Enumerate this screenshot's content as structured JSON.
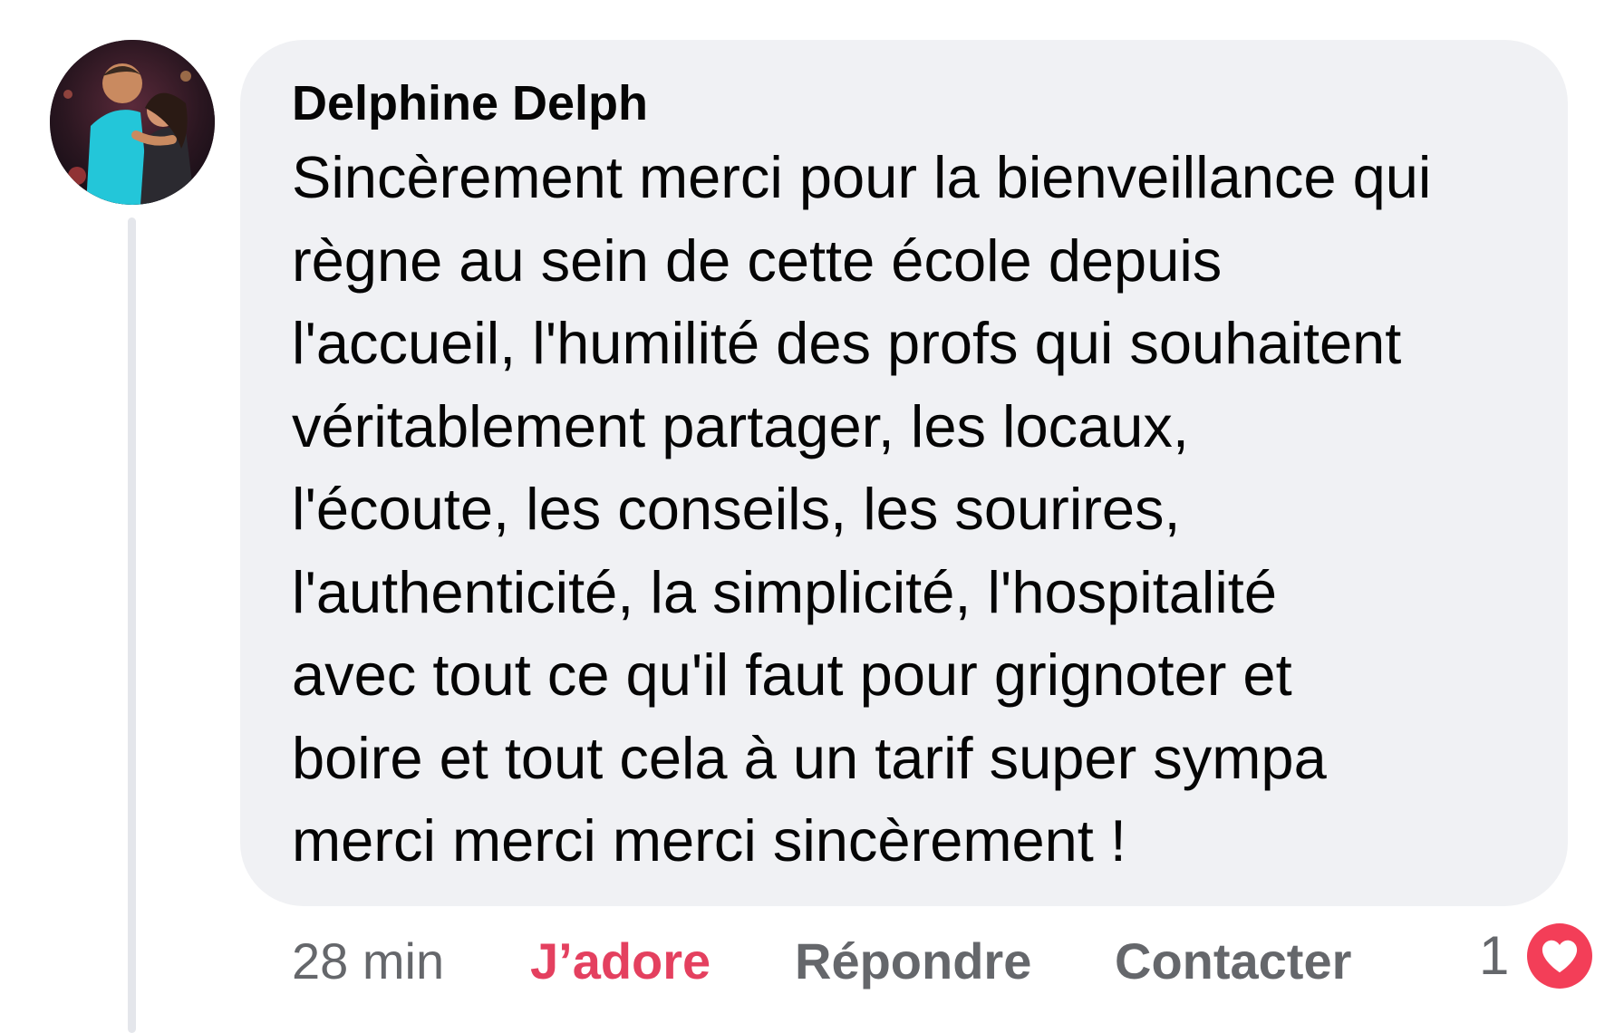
{
  "comment": {
    "author": "Delphine Delph",
    "lines": [
      "Sincèrement merci pour la bienveillance qui",
      "règne au sein de cette école depuis",
      "l'accueil, l'humilité des profs qui souhaitent",
      "véritablement partager, les locaux,",
      "l'écoute, les conseils, les sourires,",
      "l'authenticité, la simplicité, l'hospitalité",
      "avec tout ce qu'il faut pour grignoter et",
      "boire et tout cela à un tarif super sympa",
      "merci merci merci sincèrement !"
    ],
    "time": "28 min",
    "reaction_count": "1",
    "reaction_icon": "heart-icon"
  },
  "actions": {
    "adore_label": "J’adore",
    "reply_label": "Répondre",
    "contact_label": "Contacter"
  },
  "colors": {
    "bubble": "#f0f1f4",
    "text": "#050505",
    "secondary": "#65676b",
    "reaction_active": "#e4405f",
    "heart": "#f33e58"
  }
}
